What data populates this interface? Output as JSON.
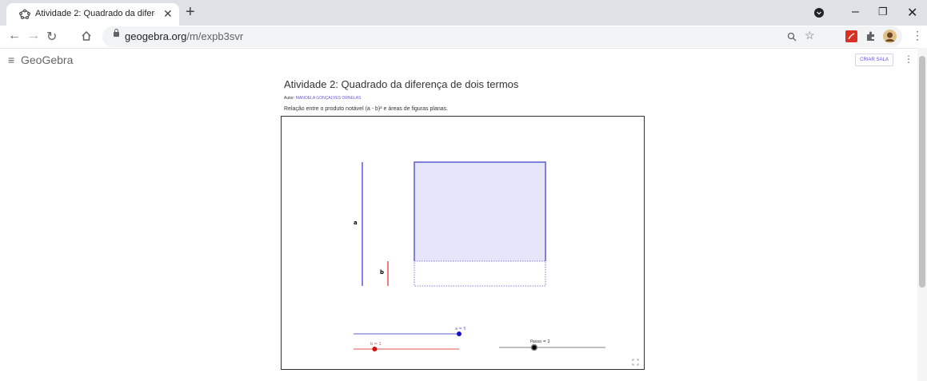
{
  "browser": {
    "tab_title": "Atividade 2: Quadrado da diferen",
    "url_domain": "geogebra.org",
    "url_path": "/m/expb3svr"
  },
  "app": {
    "logo": "GeoGebra",
    "criar_sala": "CRIAR SALA"
  },
  "page": {
    "title": "Atividade 2: Quadrado da diferença de dois termos",
    "author_label": "Autor:",
    "author_name": "MANOELA GONÇALVES ORNELAS",
    "description": "Relação entre o produto notável (a - b)² e áreas de figuras planas."
  },
  "applet": {
    "label_a": "a",
    "label_b": "b",
    "slider_a": "a = 5",
    "slider_b": "b = 1",
    "slider_passo": "Passo = 2",
    "slider_a_level": 1.0,
    "slider_b_level": 0.2,
    "slider_passo_level": 0.33,
    "colors": {
      "blue": "#5c5cd6",
      "red": "#e05252",
      "fill": "#e6e6fa",
      "gray": "#7f7f7f"
    }
  }
}
